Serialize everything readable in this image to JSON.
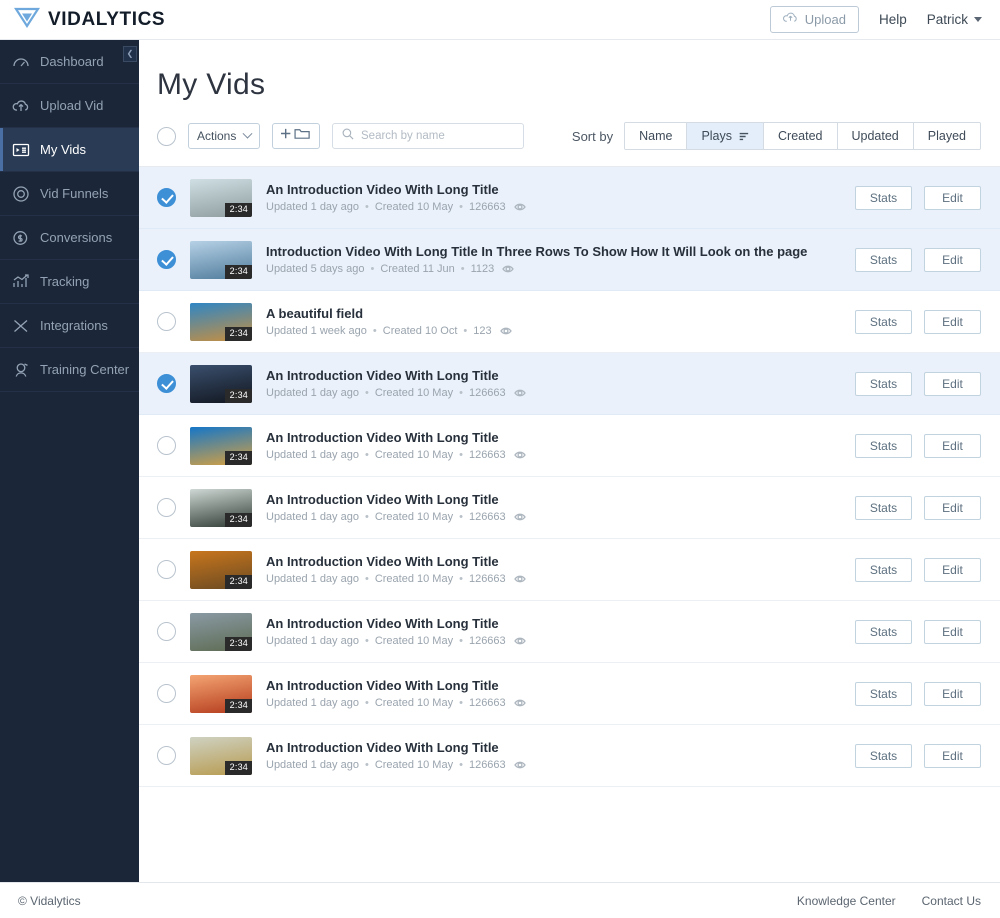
{
  "header": {
    "logo_text": "VIDALYTICS",
    "logo_icon": "vidalytics-triangle-logo",
    "upload_label": "Upload",
    "upload_icon": "cloud-upload-icon",
    "help_label": "Help",
    "user_name": "Patrick",
    "user_caret_icon": "caret-down-icon"
  },
  "sidebar": {
    "collapse_icon": "chevron-left-icon",
    "items": [
      {
        "label": "Dashboard",
        "icon": "dashboard-gauge-icon",
        "active": false
      },
      {
        "label": "Upload Vid",
        "icon": "cloud-upload-icon",
        "active": false
      },
      {
        "label": "My Vids",
        "icon": "video-list-icon",
        "active": true
      },
      {
        "label": "Vid Funnels",
        "icon": "circle-target-icon",
        "active": false
      },
      {
        "label": "Conversions",
        "icon": "dollar-circle-icon",
        "active": false
      },
      {
        "label": "Tracking",
        "icon": "bar-chart-icon",
        "active": false
      },
      {
        "label": "Integrations",
        "icon": "shuffle-icon",
        "active": false
      },
      {
        "label": "Training Center",
        "icon": "graduation-user-icon",
        "active": false
      }
    ]
  },
  "page": {
    "title": "My Vids"
  },
  "toolbar": {
    "select_all_checked": false,
    "actions_label": "Actions",
    "actions_caret_icon": "chevron-down-icon",
    "add_folder_icon": "plus-folder-icon",
    "search": {
      "icon": "search-icon",
      "value": "",
      "placeholder": "Search by name"
    },
    "sort_by_label": "Sort by",
    "sort_tabs": [
      {
        "label": "Name",
        "active": false,
        "icon": ""
      },
      {
        "label": "Plays",
        "active": true,
        "icon": "sort-descending-icon"
      },
      {
        "label": "Created",
        "active": false,
        "icon": ""
      },
      {
        "label": "Updated",
        "active": false,
        "icon": ""
      },
      {
        "label": "Played",
        "active": false,
        "icon": ""
      }
    ]
  },
  "list": {
    "stats_label": "Stats",
    "edit_label": "Edit",
    "views_icon": "eye-icon",
    "separator": "•",
    "rows": [
      {
        "title": "An Introduction Video With Long Title",
        "updated": "Updated 1 day ago",
        "created": "Created 10 May",
        "views": "126663",
        "duration": "2:34",
        "selected": true,
        "thumb_top": "#cfdfe3",
        "thumb_bottom": "#8e9c9e"
      },
      {
        "title": "Introduction Video With Long Title In Three Rows To Show How It Will Look on the page",
        "updated": "Updated 5 days ago",
        "created": "Created 11 Jun",
        "views": "1123",
        "duration": "2:34",
        "selected": true,
        "thumb_top": "#b6d1e6",
        "thumb_bottom": "#4e7b9b"
      },
      {
        "title": "A beautiful field",
        "updated": "Updated 1 week ago",
        "created": "Created 10 Oct",
        "views": "123",
        "duration": "2:34",
        "selected": false,
        "thumb_top": "#2f86c5",
        "thumb_bottom": "#c98f3e"
      },
      {
        "title": "An Introduction Video With Long Title",
        "updated": "Updated 1 day ago",
        "created": "Created 10 May",
        "views": "126663",
        "duration": "2:34",
        "selected": true,
        "thumb_top": "#3a4f6d",
        "thumb_bottom": "#11161f"
      },
      {
        "title": "An Introduction Video With Long Title",
        "updated": "Updated 1 day ago",
        "created": "Created 10 May",
        "views": "126663",
        "duration": "2:34",
        "selected": false,
        "thumb_top": "#1576c8",
        "thumb_bottom": "#d8a13f"
      },
      {
        "title": "An Introduction Video With Long Title",
        "updated": "Updated 1 day ago",
        "created": "Created 10 May",
        "views": "126663",
        "duration": "2:34",
        "selected": false,
        "thumb_top": "#cfd8d4",
        "thumb_bottom": "#2e3a33"
      },
      {
        "title": "An Introduction Video With Long Title",
        "updated": "Updated 1 day ago",
        "created": "Created 10 May",
        "views": "126663",
        "duration": "2:34",
        "selected": false,
        "thumb_top": "#c8761d",
        "thumb_bottom": "#6a4a22"
      },
      {
        "title": "An Introduction Video With Long Title",
        "updated": "Updated 1 day ago",
        "created": "Created 10 May",
        "views": "126663",
        "duration": "2:34",
        "selected": false,
        "thumb_top": "#8a9aa4",
        "thumb_bottom": "#5d6b52"
      },
      {
        "title": "An Introduction Video With Long Title",
        "updated": "Updated 1 day ago",
        "created": "Created 10 May",
        "views": "126663",
        "duration": "2:34",
        "selected": false,
        "thumb_top": "#f4a472",
        "thumb_bottom": "#b33a1c"
      },
      {
        "title": "An Introduction Video With Long Title",
        "updated": "Updated 1 day ago",
        "created": "Created 10 May",
        "views": "126663",
        "duration": "2:34",
        "selected": false,
        "thumb_top": "#cfd2c2",
        "thumb_bottom": "#b79a4e"
      }
    ]
  },
  "footer": {
    "copyright": "© Vidalytics",
    "links": [
      "Knowledge Center",
      "Contact Us"
    ]
  },
  "colors": {
    "sidebar_bg": "#1b2638",
    "sidebar_active_bg": "#2a3c55",
    "accent_blue": "#3d8fd6",
    "row_selected_bg": "#eaf1fb",
    "sort_active_bg": "#e3eefa"
  }
}
